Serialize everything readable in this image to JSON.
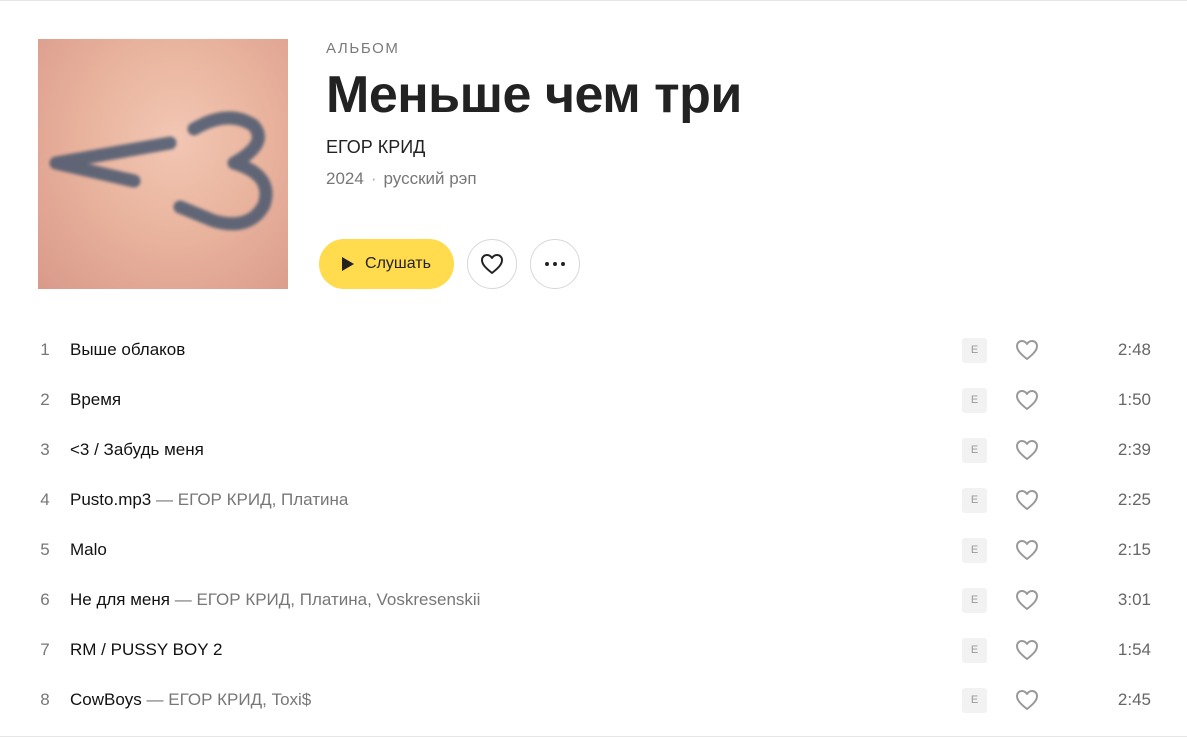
{
  "album": {
    "type_label": "АЛЬБОМ",
    "title": "Меньше чем три",
    "artist": "ЕГОР КРИД",
    "year": "2024",
    "genre": "русский рэп",
    "cover_text": "<3"
  },
  "actions": {
    "play_label": "Слушать",
    "like_icon": "heart-icon",
    "more_icon": "more-dots-icon"
  },
  "colors": {
    "accent": "#ffdb4d"
  },
  "tracks": [
    {
      "num": "1",
      "title": "Выше облаков",
      "artists": "",
      "explicit": "E",
      "duration": "2:48"
    },
    {
      "num": "2",
      "title": "Время",
      "artists": "",
      "explicit": "E",
      "duration": "1:50"
    },
    {
      "num": "3",
      "title": "<3 / Забудь меня",
      "artists": "",
      "explicit": "E",
      "duration": "2:39"
    },
    {
      "num": "4",
      "title": "Pusto.mp3",
      "artists": "ЕГОР КРИД, Платина",
      "explicit": "E",
      "duration": "2:25"
    },
    {
      "num": "5",
      "title": "Malo",
      "artists": "",
      "explicit": "E",
      "duration": "2:15"
    },
    {
      "num": "6",
      "title": "Не для меня",
      "artists": "ЕГОР КРИД, Платина, Voskresenskii",
      "explicit": "E",
      "duration": "3:01"
    },
    {
      "num": "7",
      "title": "RM / PUSSY BOY 2",
      "artists": "",
      "explicit": "E",
      "duration": "1:54"
    },
    {
      "num": "8",
      "title": "CowBoys",
      "artists": "ЕГОР КРИД, Toxi$",
      "explicit": "E",
      "duration": "2:45"
    }
  ]
}
